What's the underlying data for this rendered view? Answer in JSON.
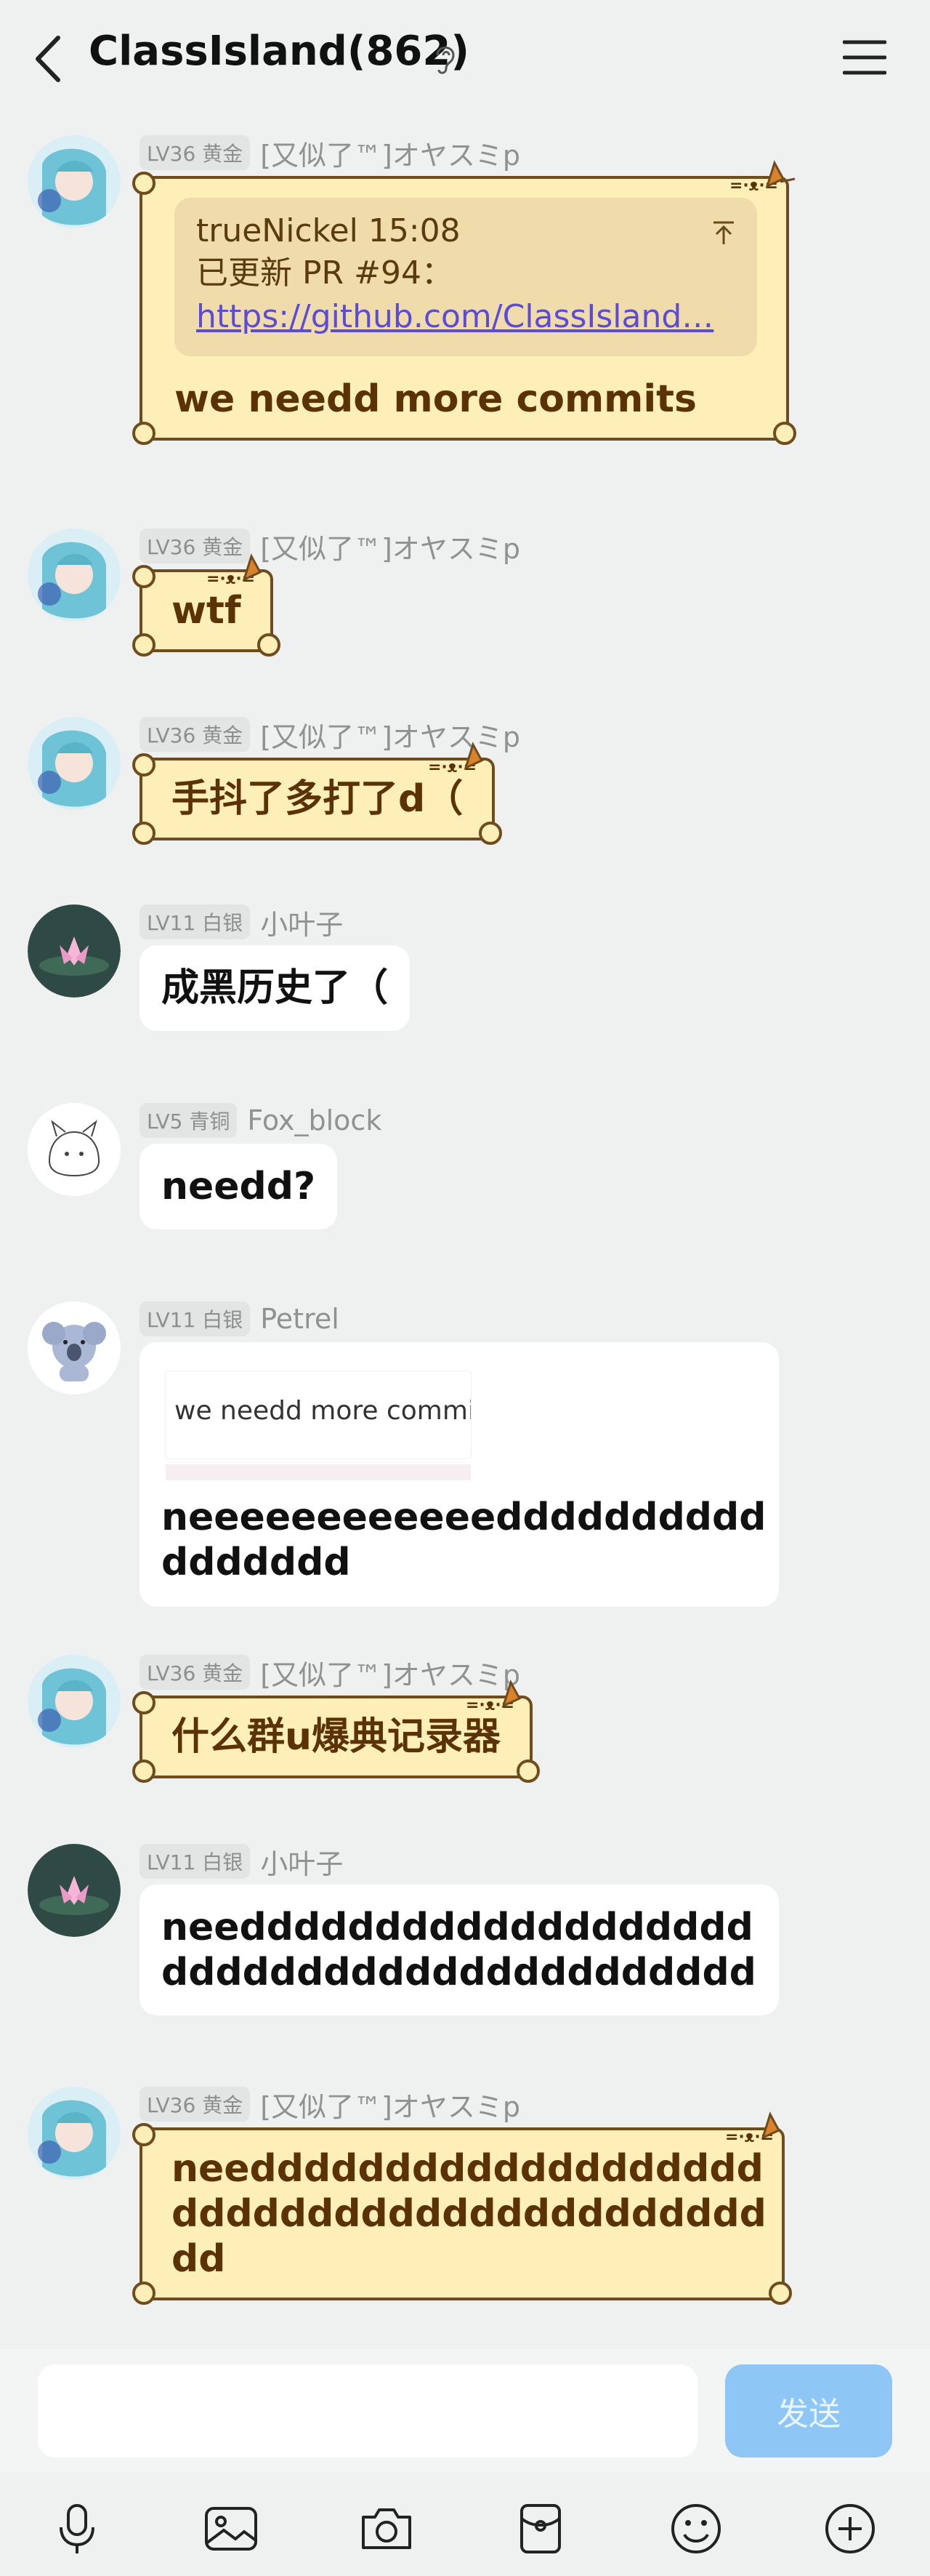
{
  "header": {
    "title": "ClassIsland(862)"
  },
  "messages": [
    {
      "level": "LV36",
      "tier": "黄金",
      "nick": "[又似了™]オヤスミp",
      "quote": {
        "head": "trueNickel 15:08",
        "body": "已更新 PR #94：",
        "link": "https://github.com/ClassIsland…"
      },
      "text": "we needd more commits"
    },
    {
      "level": "LV36",
      "tier": "黄金",
      "nick": "[又似了™]オヤスミp",
      "text": "wtf"
    },
    {
      "level": "LV36",
      "tier": "黄金",
      "nick": "[又似了™]オヤスミp",
      "text": "手抖了多打了d（"
    },
    {
      "level": "LV11",
      "tier": "白银",
      "nick": "小叶子",
      "text": "成黑历史了（"
    },
    {
      "level": "LV5",
      "tier": "青铜",
      "nick": "Fox_block",
      "text": "needd?"
    },
    {
      "level": "LV11",
      "tier": "白银",
      "nick": "Petrel",
      "image_quote": "we needd more commits",
      "text_line1": "neeeeeeeeeeeedddddddddd",
      "text_line2": "ddddddd"
    },
    {
      "level": "LV36",
      "tier": "黄金",
      "nick": "[又似了™]オヤスミp",
      "text": "什么群u爆典记录器"
    },
    {
      "level": "LV11",
      "tier": "白银",
      "nick": "小叶子",
      "text_line1": "needdddddddddddddddddd",
      "text_line2": "dddddddddddddddddddddd"
    },
    {
      "level": "LV36",
      "tier": "黄金",
      "nick": "[又似了™]オヤスミp",
      "text_line1": "needdddddddddddddddddd",
      "text_line2": "dddddddddddddddddddddd",
      "text_line3": "dd"
    }
  ],
  "composer": {
    "input_value": "",
    "send_label": "发送"
  },
  "toolbar": {
    "icons": [
      "microphone-icon",
      "image-icon",
      "camera-icon",
      "red-packet-icon",
      "emoji-icon",
      "plus-icon"
    ]
  },
  "colors": {
    "scroll_bg": "#fdefb7",
    "scroll_text": "#5a3206",
    "send_bg": "#8ec7f5",
    "link": "#5b4bd8"
  }
}
